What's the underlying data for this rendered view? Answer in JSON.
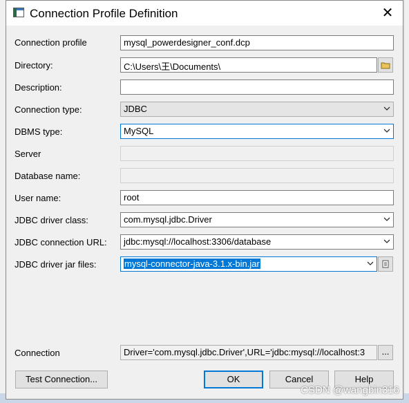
{
  "window": {
    "title": "Connection Profile Definition"
  },
  "labels": {
    "connection_profile": "Connection profile",
    "directory": "Directory:",
    "description": "Description:",
    "connection_type": "Connection type:",
    "dbms_type": "DBMS type:",
    "server": "Server",
    "database_name": "Database name:",
    "user_name": "User name:",
    "jdbc_driver_class": "JDBC driver class:",
    "jdbc_connection_url": "JDBC connection URL:",
    "jdbc_driver_jar_files": "JDBC driver jar files:",
    "connection": "Connection"
  },
  "values": {
    "connection_profile": "mysql_powerdesigner_conf.dcp",
    "directory": "C:\\Users\\王\\Documents\\",
    "description": "",
    "connection_type": "JDBC",
    "dbms_type": "MySQL",
    "server": "",
    "database_name": "",
    "user_name": "root",
    "jdbc_driver_class": "com.mysql.jdbc.Driver",
    "jdbc_connection_url": "jdbc:mysql://localhost:3306/database",
    "jdbc_driver_jar_files": "mysql-connector-java-3.1.x-bin.jar",
    "connection": "Driver='com.mysql.jdbc.Driver',URL='jdbc:mysql://localhost:3"
  },
  "buttons": {
    "ellipsis": "...",
    "test_connection": "Test Connection...",
    "ok": "OK",
    "cancel": "Cancel",
    "help": "Help"
  },
  "watermark": "CSDN @wangbin316",
  "icons": {
    "close": "close-icon",
    "folder": "folder-icon",
    "file_list": "file-list-icon",
    "chevron": "chevron-down-icon"
  },
  "colors": {
    "accent": "#0078d7",
    "dialog_bg": "#f0f0f0"
  }
}
